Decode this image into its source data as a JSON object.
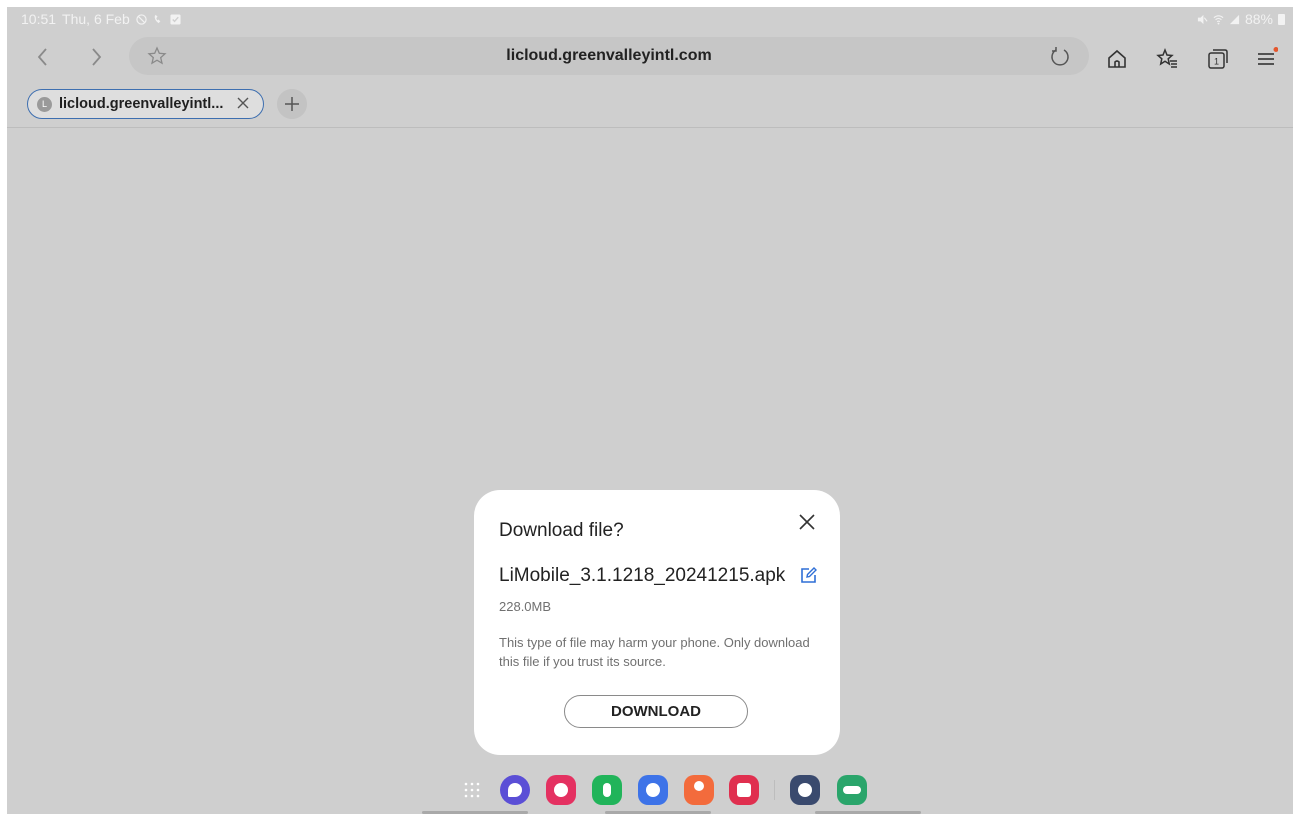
{
  "status_bar": {
    "time": "10:51",
    "date": "Thu, 6 Feb",
    "battery": "88%"
  },
  "browser": {
    "url": "licloud.greenvalleyintl.com",
    "tab_title": "licloud.greenvalleyintl...",
    "tab_favicon_letter": "L",
    "icons": {
      "back": "back-icon",
      "forward": "forward-icon",
      "bookmark": "star-icon",
      "reload": "reload-icon",
      "home": "home-icon",
      "bookmarks": "bookmarks-icon",
      "tabs": "tabs-icon",
      "menu": "menu-icon"
    },
    "tabs_count": "1"
  },
  "dialog": {
    "title": "Download file?",
    "filename": "LiMobile_3.1.1218_20241215.apk",
    "size": "228.0MB",
    "warning": "This type of file may harm your phone. Only download this file if you trust its source.",
    "button": "DOWNLOAD"
  },
  "dock": {
    "apps": [
      "apps-grid-icon",
      "internet-icon",
      "flower-icon",
      "phone-icon",
      "messages-icon",
      "contacts-icon",
      "camera-icon",
      "settings-icon",
      "game-icon"
    ]
  },
  "colors": {
    "background": "#cfcfcf",
    "tab_border": "#3e6fb0",
    "edit_icon": "#2f6fd6",
    "notification_dot": "#e4572e"
  }
}
